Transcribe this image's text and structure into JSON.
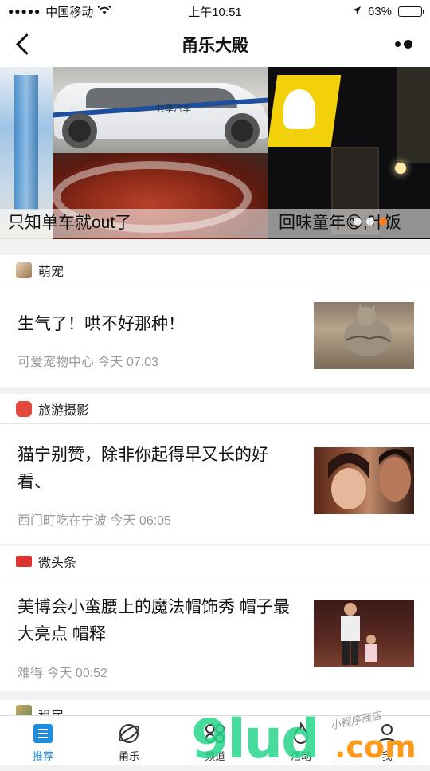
{
  "status": {
    "carrier": "中国移动",
    "time": "上午10:51",
    "battery": "63%",
    "battery_level": 0.63
  },
  "nav": {
    "title": "甬乐大殿"
  },
  "banner": {
    "captions": [
      "只知单车就out了",
      "回味童年😋,叶饭"
    ],
    "car_text": "共享汽车",
    "active_dot": 2
  },
  "sections": [
    {
      "category": "萌宠",
      "icon_color": "#c9a27a",
      "title": "生气了！哄不好那种！",
      "source": "可爱宠物中心",
      "time": "今天 07:03"
    },
    {
      "category": "旅游摄影",
      "icon_color": "#e2493a",
      "title": "猫宁别赞，除非你起得早又长的好看、",
      "source": "西门町吃在宁波",
      "time": "今天 06:05"
    },
    {
      "category": "微头条",
      "icon_color": "#e0322e",
      "title": "美博会小蛮腰上的魔法帽饰秀 帽子最大亮点 帽释",
      "source": "难得",
      "time": "今天 00:52"
    },
    {
      "category": "租房",
      "icon_color": "#8a6a3a"
    }
  ],
  "tabs": [
    {
      "label": "推荐",
      "icon": "list-icon",
      "active": true
    },
    {
      "label": "甬乐",
      "icon": "planet-icon",
      "active": false
    },
    {
      "label": "频道",
      "icon": "grid-icon",
      "active": false
    },
    {
      "label": "活动",
      "icon": "flame-icon",
      "active": false
    },
    {
      "label": "我",
      "icon": "user-icon",
      "active": false
    }
  ],
  "watermark": {
    "text": "9lud",
    "domain": ".com",
    "sub": "小程序商店"
  },
  "colors": {
    "accent": "#1e8fdc",
    "indicator": "#ff7a1a"
  }
}
